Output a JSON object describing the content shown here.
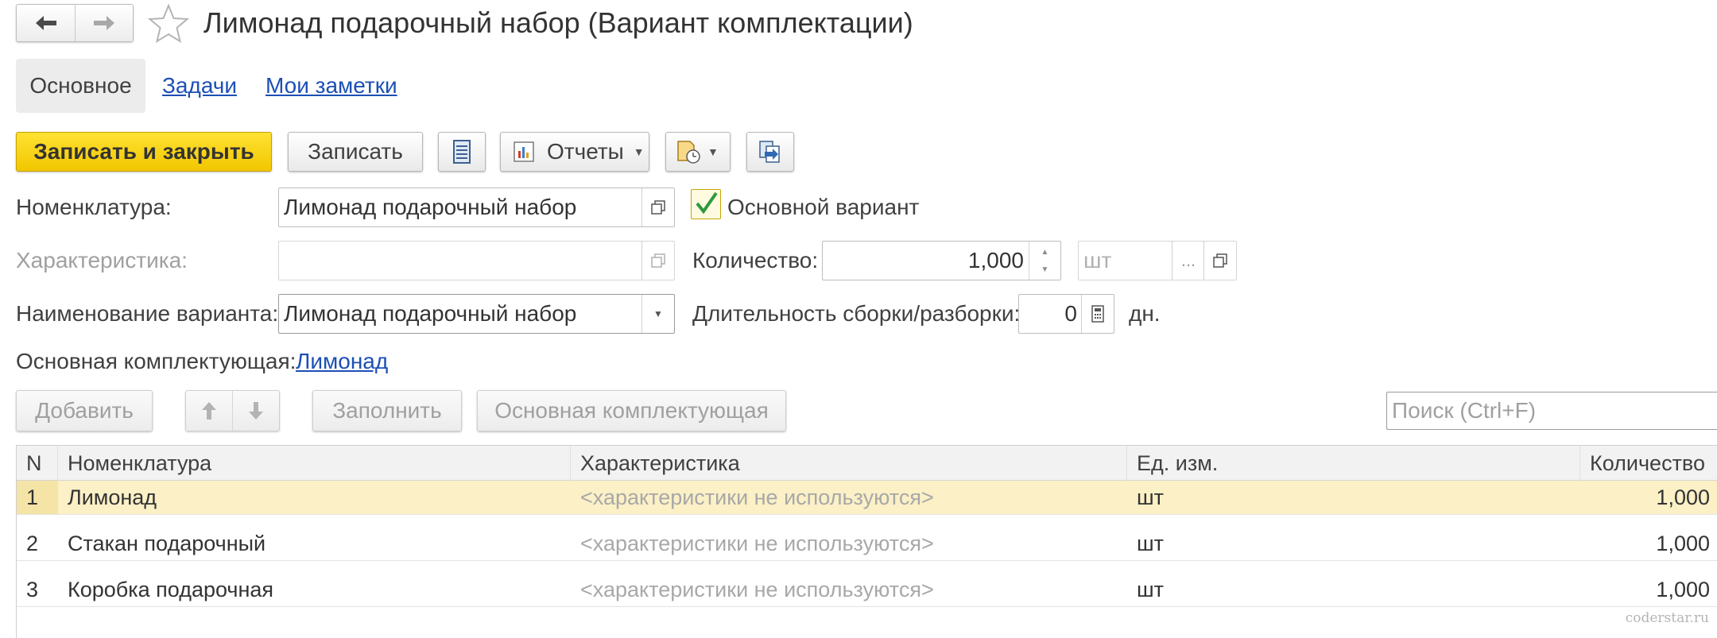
{
  "window": {
    "title": "Лимонад подарочный набор (Вариант комплектации)"
  },
  "tabs": [
    {
      "label": "Основное",
      "active": true
    },
    {
      "label": "Задачи",
      "active": false
    },
    {
      "label": "Мои заметки",
      "active": false
    }
  ],
  "toolbar": {
    "save_close_label": "Записать и закрыть",
    "save_label": "Записать",
    "reports_label": "Отчеты"
  },
  "form": {
    "nomenclature_label": "Номенклатура:",
    "nomenclature_value": "Лимонад подарочный набор",
    "main_variant_label": "Основной вариант",
    "main_variant_checked": true,
    "characteristic_label": "Характеристика:",
    "characteristic_value": "",
    "quantity_label": "Количество:",
    "quantity_value": "1,000",
    "unit_placeholder": "шт",
    "unit_more": "...",
    "variant_name_label": "Наименование варианта:",
    "variant_name_value": "Лимонад подарочный набор",
    "duration_label": "Длительность сборки/разборки:",
    "duration_value": "0",
    "duration_unit": "дн.",
    "main_component_label": "Основная комплектующая:",
    "main_component_link": "Лимонад"
  },
  "table_toolbar": {
    "add_label": "Добавить",
    "fill_label": "Заполнить",
    "main_component_label": "Основная комплектующая",
    "search_placeholder": "Поиск (Ctrl+F)"
  },
  "table": {
    "columns": [
      "N",
      "Номенклатура",
      "Характеристика",
      "Ед. изм.",
      "Количество"
    ],
    "rows": [
      {
        "n": "1",
        "name": "Лимонад",
        "characteristic": "<характеристики не используются>",
        "unit": "шт",
        "qty": "1,000"
      },
      {
        "n": "2",
        "name": "Стакан подарочный",
        "characteristic": "<характеристики не используются>",
        "unit": "шт",
        "qty": "1,000"
      },
      {
        "n": "3",
        "name": "Коробка подарочная",
        "characteristic": "<характеристики не используются>",
        "unit": "шт",
        "qty": "1,000"
      }
    ]
  },
  "watermark": "coderstar.ru",
  "colors": {
    "accent_yellow": "#f2c600",
    "link_blue": "#1c4fb5",
    "selected_row": "#fbf0c6",
    "checkbox_green": "#2e9a3d"
  }
}
